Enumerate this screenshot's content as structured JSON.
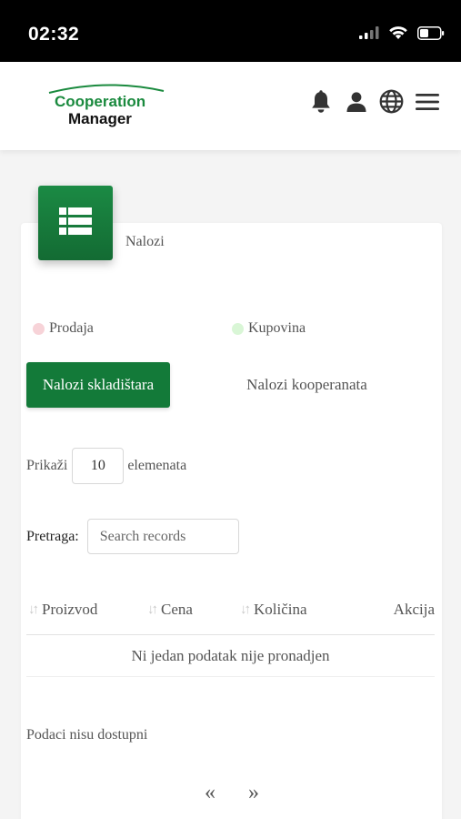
{
  "status_bar": {
    "time": "02:32",
    "icons": [
      "signal-icon",
      "wifi-icon",
      "battery-icon"
    ]
  },
  "header": {
    "logo_line1": "Cooperation",
    "logo_line2": "Manager",
    "icons": [
      "bell-icon",
      "user-icon",
      "globe-icon",
      "hamburger-menu-icon"
    ]
  },
  "colors": {
    "brand_green": "#137a39",
    "prodaja_dot": "#f7d3d8",
    "kupovina_dot": "#d9f6d6"
  },
  "card": {
    "icon": "list-icon",
    "title": "Nalozi"
  },
  "legend": {
    "prodaja": "Prodaja",
    "kupovina": "Kupovina"
  },
  "tabs": {
    "active": "Nalozi skladištara",
    "inactive": "Nalozi kooperanata"
  },
  "length": {
    "prefix": "Prikaži",
    "value": "10",
    "suffix": "elemenata"
  },
  "search": {
    "label": "Pretraga:",
    "placeholder": "Search records"
  },
  "table": {
    "columns": [
      "Proizvod",
      "Cena",
      "Količina",
      "Akcija"
    ],
    "empty_message": "Ni jedan podatak nije pronadjen"
  },
  "info": "Podaci nisu dostupni",
  "pagination": {
    "prev": "«",
    "next": "»"
  }
}
